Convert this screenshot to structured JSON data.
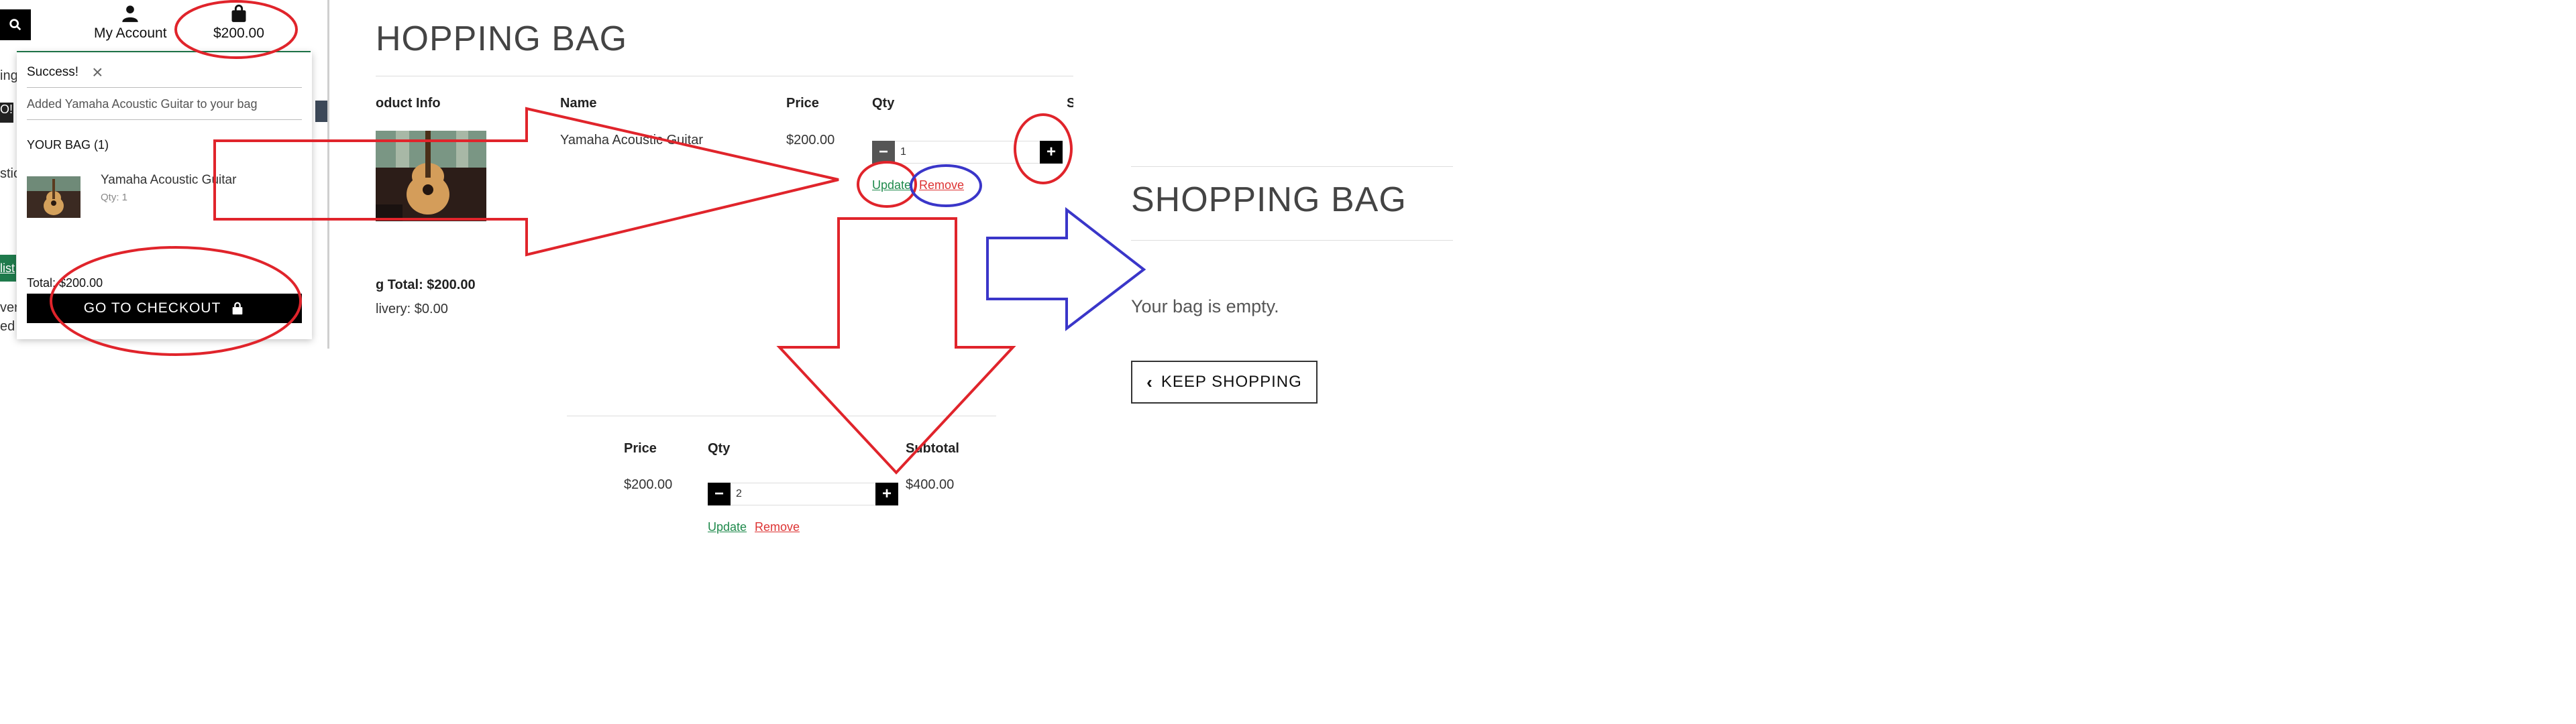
{
  "left_panel": {
    "my_account": "My Account",
    "bag_total": "$200.00",
    "edge_text": [
      "ing",
      "O!",
      "stic",
      "list",
      "ver",
      "ed"
    ],
    "toast": {
      "success": "Success!",
      "message": "Added Yamaha Acoustic Guitar to your bag",
      "your_bag": "YOUR BAG (1)",
      "item_name": "Yamaha Acoustic Guitar",
      "item_qty": "Qty: 1",
      "total": "Total: $200.00",
      "checkout_label": "GO TO CHECKOUT"
    }
  },
  "bag_panel": {
    "title": "HOPPING BAG",
    "headers": [
      "oduct Info",
      "Name",
      "Price",
      "Qty",
      "S"
    ],
    "row": {
      "name": "Yamaha Acoustic Guitar",
      "price": "$200.00",
      "qty": "1",
      "update": "Update",
      "remove": "Remove"
    },
    "bag_total": "g Total: $200.00",
    "delivery": "livery: $0.00"
  },
  "updated_panel": {
    "headers": [
      "Price",
      "Qty",
      "Subtotal"
    ],
    "price": "$200.00",
    "qty": "2",
    "subtotal": "$400.00",
    "update": "Update",
    "remove": "Remove"
  },
  "empty_panel": {
    "title": "SHOPPING BAG",
    "message": "Your bag is empty.",
    "keep_shopping": "KEEP SHOPPING"
  },
  "colors": {
    "annotation_red": "#e0242b",
    "annotation_blue": "#3a36c9",
    "brand_green": "#1f7a4c"
  }
}
